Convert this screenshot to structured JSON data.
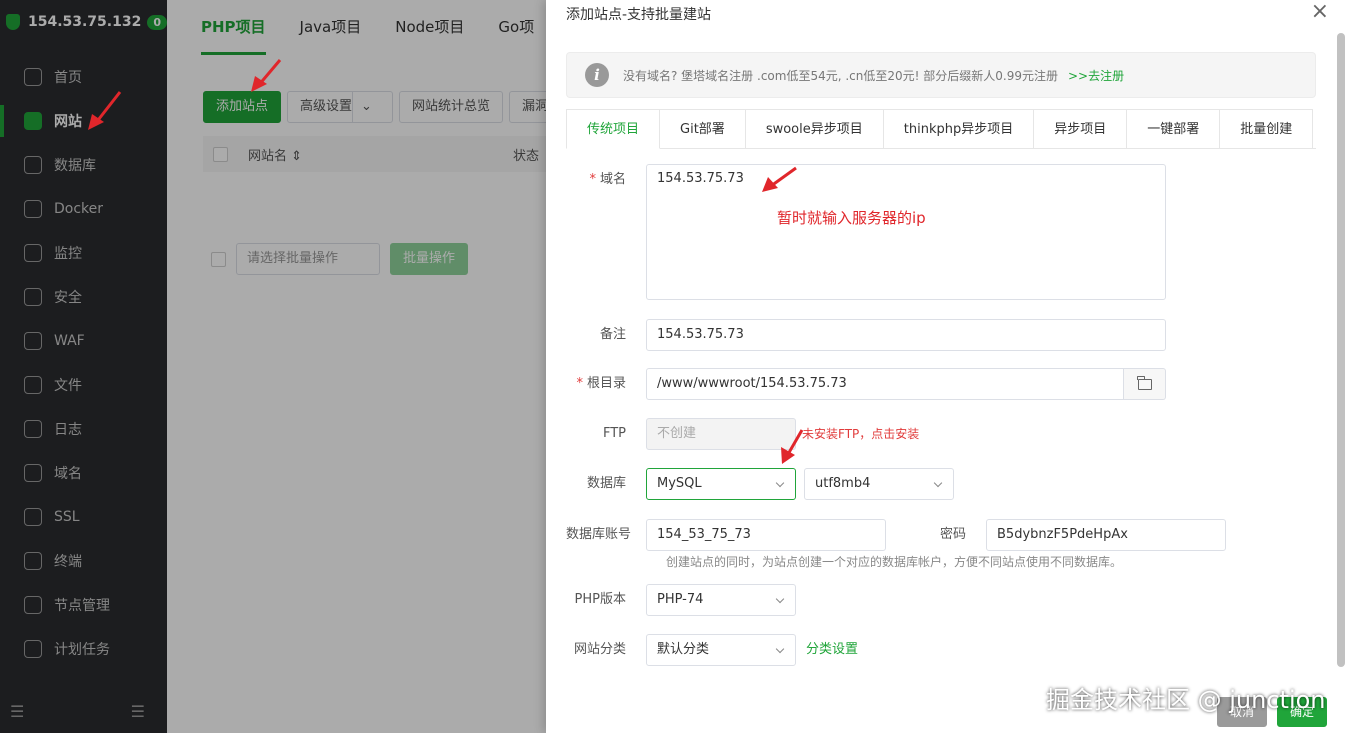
{
  "sidebar": {
    "server_ip": "154.53.75.132",
    "badge": "0",
    "items": [
      {
        "label": "首页",
        "icon": "home-icon"
      },
      {
        "label": "网站",
        "icon": "globe-window-icon",
        "active": true
      },
      {
        "label": "数据库",
        "icon": "database-icon"
      },
      {
        "label": "Docker",
        "icon": "docker-icon"
      },
      {
        "label": "监控",
        "icon": "monitor-icon"
      },
      {
        "label": "安全",
        "icon": "shield-icon"
      },
      {
        "label": "WAF",
        "icon": "firewall-icon"
      },
      {
        "label": "文件",
        "icon": "folder-icon"
      },
      {
        "label": "日志",
        "icon": "log-icon"
      },
      {
        "label": "域名",
        "icon": "domain-icon"
      },
      {
        "label": "SSL",
        "icon": "ssl-icon"
      },
      {
        "label": "终端",
        "icon": "terminal-icon"
      },
      {
        "label": "节点管理",
        "icon": "nodes-icon"
      },
      {
        "label": "计划任务",
        "icon": "calendar-icon"
      }
    ]
  },
  "main": {
    "tabs": [
      "PHP项目",
      "Java项目",
      "Node项目",
      "Go项"
    ],
    "toolbar": {
      "add_site": "添加站点",
      "advanced": "高级设置",
      "stats": "网站统计总览",
      "leak": "漏洞"
    },
    "table_headers": {
      "name": "网站名 ⇕",
      "status": "状态"
    },
    "batch": {
      "placeholder": "请选择批量操作",
      "button": "批量操作"
    }
  },
  "dialog": {
    "title": "添加站点-支持批量建站",
    "close": "×",
    "notice": {
      "text": "没有域名? 堡塔域名注册 .com低至54元,  .cn低至20元! 部分后缀新人0.99元注册",
      "link": ">>去注册"
    },
    "tabs": [
      "传统项目",
      "Git部署",
      "swoole异步项目",
      "thinkphp异步项目",
      "异步项目",
      "一键部署",
      "批量创建"
    ],
    "form": {
      "domain_label": "域名",
      "domain_value": "154.53.75.73",
      "remark_label": "备注",
      "remark_value": "154.53.75.73",
      "root_label": "根目录",
      "root_value": "/www/wwwroot/154.53.75.73",
      "ftp_label": "FTP",
      "ftp_value": "不创建",
      "ftp_warning": "未安装FTP，点击安装",
      "db_label": "数据库",
      "db_type": "MySQL",
      "db_charset": "utf8mb4",
      "db_account_label": "数据库账号",
      "db_account": "154_53_75_73",
      "password_label": "密码",
      "password": "B5dybnzF5PdeHpAx",
      "db_hint": "创建站点的同时，为站点创建一个对应的数据库帐户，方便不同站点使用不同数据库。",
      "php_label": "PHP版本",
      "php_value": "PHP-74",
      "category_label": "网站分类",
      "category_value": "默认分类",
      "category_link": "分类设置"
    },
    "buttons": {
      "cancel": "取消",
      "confirm": "确定"
    }
  },
  "annotation": "暂时就输入服务器的ip",
  "watermark": "掘金技术社区 @ junction",
  "colors": {
    "brand_green": "#20a53a",
    "annotation_red": "#e0262b",
    "sidebar_bg": "#2a2c2f"
  }
}
